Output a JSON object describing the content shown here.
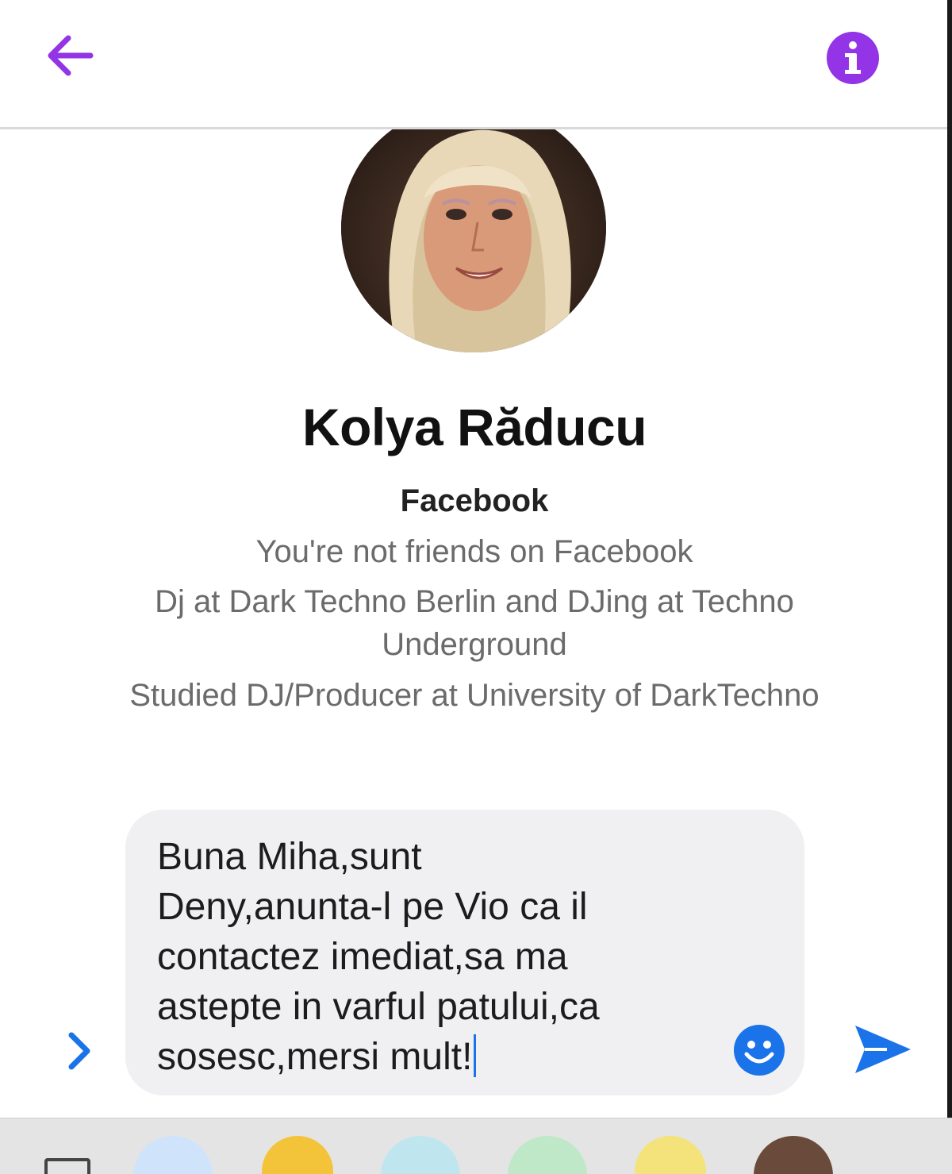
{
  "colors": {
    "accent_purple": "#9334e6",
    "messenger_blue": "#1a73e8",
    "composer_bg": "#f0f0f2",
    "secondary_text": "#6b6b6b"
  },
  "header": {
    "back_icon": "arrow-left-icon",
    "info_icon": "info-circle-icon"
  },
  "profile": {
    "name": "Kolya Răducu",
    "source": "Facebook",
    "friend_status": "You're not friends on Facebook",
    "work_line_1": "Dj at Dark Techno Berlin and DJing at Techno",
    "work_line_2": "Underground",
    "education": "Studied DJ/Producer at University of DarkTechno"
  },
  "composer": {
    "message_value": "Buna Miha,sunt\nDeny,anunta-l pe Vio ca il\ncontactez imediat,sa ma\nastepte in varful patului,ca\nsosesc,mersi mult!",
    "emoji_icon": "smiley-icon",
    "send_icon": "send-icon",
    "expand_icon": "chevron-right-icon"
  }
}
